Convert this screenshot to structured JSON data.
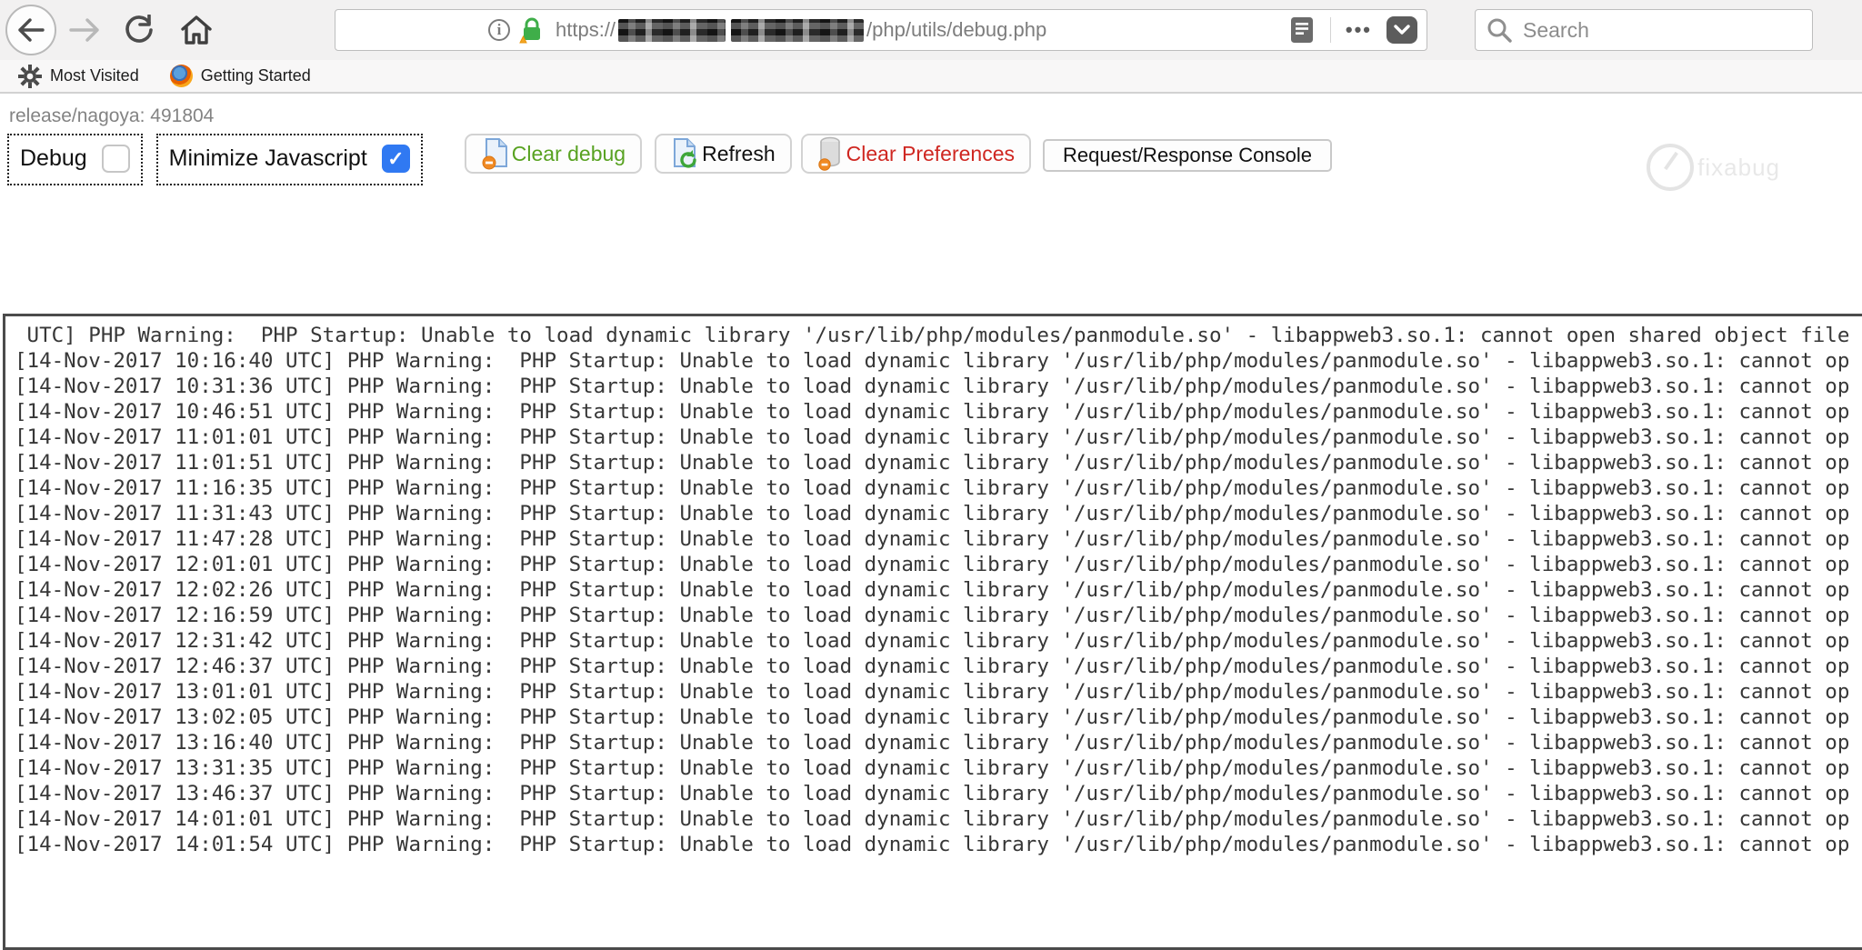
{
  "browser": {
    "url": {
      "scheme": "https:",
      "path": "/php/utils/debug.php"
    },
    "page_actions_dots": "•••",
    "search": {
      "placeholder": "Search"
    },
    "bookmarks": {
      "most_visited": "Most Visited",
      "getting_started": "Getting Started"
    }
  },
  "page": {
    "release_line": "release/nagoya: 491804",
    "controls": {
      "debug_label": "Debug",
      "debug_checked": false,
      "minimize_label": "Minimize Javascript",
      "minimize_checked": true,
      "check_glyph": "✓",
      "clear_debug_label": "Clear debug",
      "refresh_label": "Refresh",
      "clear_prefs_label": "Clear Preferences",
      "console_label": "Request/Response Console"
    },
    "colors": {
      "clear_debug_text": "#58a221",
      "clear_prefs_text": "#cf2721",
      "checkbox_accent": "#3079f2"
    },
    "log": {
      "lines": [
        " UTC] PHP Warning:  PHP Startup: Unable to load dynamic library '/usr/lib/php/modules/panmodule.so' - libappweb3.so.1: cannot open shared object file",
        "[14-Nov-2017 10:16:40 UTC] PHP Warning:  PHP Startup: Unable to load dynamic library '/usr/lib/php/modules/panmodule.so' - libappweb3.so.1: cannot op",
        "[14-Nov-2017 10:31:36 UTC] PHP Warning:  PHP Startup: Unable to load dynamic library '/usr/lib/php/modules/panmodule.so' - libappweb3.so.1: cannot op",
        "[14-Nov-2017 10:46:51 UTC] PHP Warning:  PHP Startup: Unable to load dynamic library '/usr/lib/php/modules/panmodule.so' - libappweb3.so.1: cannot op",
        "[14-Nov-2017 11:01:01 UTC] PHP Warning:  PHP Startup: Unable to load dynamic library '/usr/lib/php/modules/panmodule.so' - libappweb3.so.1: cannot op",
        "[14-Nov-2017 11:01:51 UTC] PHP Warning:  PHP Startup: Unable to load dynamic library '/usr/lib/php/modules/panmodule.so' - libappweb3.so.1: cannot op",
        "[14-Nov-2017 11:16:35 UTC] PHP Warning:  PHP Startup: Unable to load dynamic library '/usr/lib/php/modules/panmodule.so' - libappweb3.so.1: cannot op",
        "[14-Nov-2017 11:31:43 UTC] PHP Warning:  PHP Startup: Unable to load dynamic library '/usr/lib/php/modules/panmodule.so' - libappweb3.so.1: cannot op",
        "[14-Nov-2017 11:47:28 UTC] PHP Warning:  PHP Startup: Unable to load dynamic library '/usr/lib/php/modules/panmodule.so' - libappweb3.so.1: cannot op",
        "[14-Nov-2017 12:01:01 UTC] PHP Warning:  PHP Startup: Unable to load dynamic library '/usr/lib/php/modules/panmodule.so' - libappweb3.so.1: cannot op",
        "[14-Nov-2017 12:02:26 UTC] PHP Warning:  PHP Startup: Unable to load dynamic library '/usr/lib/php/modules/panmodule.so' - libappweb3.so.1: cannot op",
        "[14-Nov-2017 12:16:59 UTC] PHP Warning:  PHP Startup: Unable to load dynamic library '/usr/lib/php/modules/panmodule.so' - libappweb3.so.1: cannot op",
        "[14-Nov-2017 12:31:42 UTC] PHP Warning:  PHP Startup: Unable to load dynamic library '/usr/lib/php/modules/panmodule.so' - libappweb3.so.1: cannot op",
        "[14-Nov-2017 12:46:37 UTC] PHP Warning:  PHP Startup: Unable to load dynamic library '/usr/lib/php/modules/panmodule.so' - libappweb3.so.1: cannot op",
        "[14-Nov-2017 13:01:01 UTC] PHP Warning:  PHP Startup: Unable to load dynamic library '/usr/lib/php/modules/panmodule.so' - libappweb3.so.1: cannot op",
        "[14-Nov-2017 13:02:05 UTC] PHP Warning:  PHP Startup: Unable to load dynamic library '/usr/lib/php/modules/panmodule.so' - libappweb3.so.1: cannot op",
        "[14-Nov-2017 13:16:40 UTC] PHP Warning:  PHP Startup: Unable to load dynamic library '/usr/lib/php/modules/panmodule.so' - libappweb3.so.1: cannot op",
        "[14-Nov-2017 13:31:35 UTC] PHP Warning:  PHP Startup: Unable to load dynamic library '/usr/lib/php/modules/panmodule.so' - libappweb3.so.1: cannot op",
        "[14-Nov-2017 13:46:37 UTC] PHP Warning:  PHP Startup: Unable to load dynamic library '/usr/lib/php/modules/panmodule.so' - libappweb3.so.1: cannot op",
        "[14-Nov-2017 14:01:01 UTC] PHP Warning:  PHP Startup: Unable to load dynamic library '/usr/lib/php/modules/panmodule.so' - libappweb3.so.1: cannot op",
        "[14-Nov-2017 14:01:54 UTC] PHP Warning:  PHP Startup: Unable to load dynamic library '/usr/lib/php/modules/panmodule.so' - libappweb3.so.1: cannot op"
      ]
    },
    "watermark": "fixabug"
  }
}
